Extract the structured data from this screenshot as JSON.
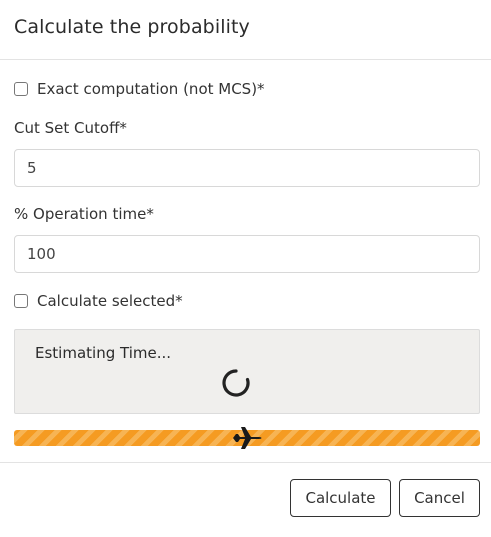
{
  "dialog": {
    "title": "Calculate the probability"
  },
  "form": {
    "exact_computation": {
      "label": "Exact computation (not MCS)*",
      "checked": false
    },
    "cut_set_cutoff": {
      "label": "Cut Set Cutoff*",
      "value": "5"
    },
    "operation_time": {
      "label": "% Operation time*",
      "value": "100"
    },
    "calculate_selected": {
      "label": "Calculate selected*",
      "checked": false
    }
  },
  "status": {
    "estimating_text": "Estimating Time...",
    "spinner_icon": "loading-spinner-icon",
    "progress_icon": "airplane-icon",
    "progress_value": 1.0,
    "colors": {
      "progress_stripe_dark": "#f59b22",
      "progress_stripe_light": "#f7b454",
      "panel_bg": "#f0efed"
    }
  },
  "footer": {
    "calculate_label": "Calculate",
    "cancel_label": "Cancel"
  }
}
